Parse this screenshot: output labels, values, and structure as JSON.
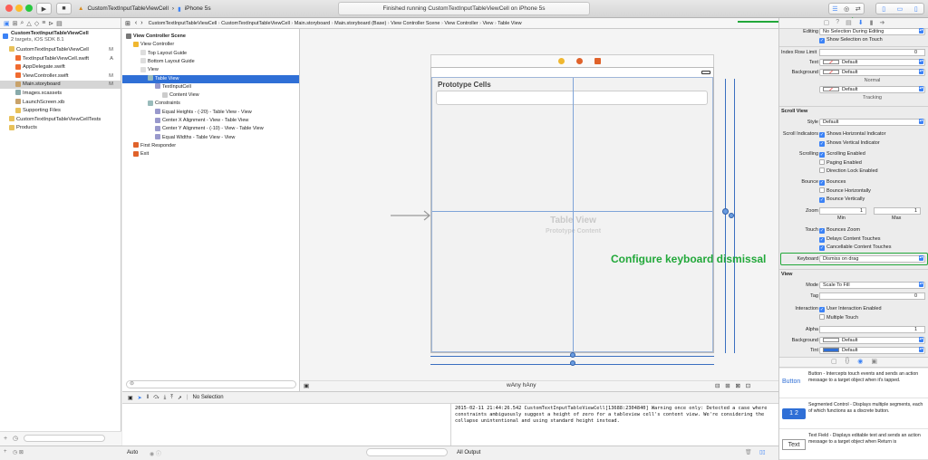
{
  "window": {
    "scheme": "CustomTextInputTableViewCell",
    "device": "iPhone 5s",
    "status": "Finished running CustomTextInputTableViewCell on iPhone 5s"
  },
  "jumpbar": [
    "CustomTextInputTableViewCell",
    "CustomTextInputTableViewCell",
    "Main.storyboard",
    "Main.storyboard (Base)",
    "View Controller Scene",
    "View Controller",
    "View",
    "Table View"
  ],
  "navigator": {
    "project": "CustomTextInputTableViewCell",
    "project_sub": "2 targets, iOS SDK 8.1",
    "items": [
      {
        "label": "CustomTextInputTableViewCell",
        "indent": 1,
        "kind": "folder",
        "flag": "M"
      },
      {
        "label": "TextInputTableViewCell.swift",
        "indent": 2,
        "kind": "swift",
        "flag": "A"
      },
      {
        "label": "AppDelegate.swift",
        "indent": 2,
        "kind": "swift",
        "flag": ""
      },
      {
        "label": "ViewController.swift",
        "indent": 2,
        "kind": "swift",
        "flag": "M"
      },
      {
        "label": "Main.storyboard",
        "indent": 2,
        "kind": "storyboard",
        "flag": "M",
        "selected": true
      },
      {
        "label": "Images.xcassets",
        "indent": 2,
        "kind": "assets",
        "flag": ""
      },
      {
        "label": "LaunchScreen.xib",
        "indent": 2,
        "kind": "xib",
        "flag": ""
      },
      {
        "label": "Supporting Files",
        "indent": 2,
        "kind": "folder",
        "flag": ""
      },
      {
        "label": "CustomTextInputTableViewCellTests",
        "indent": 1,
        "kind": "folder",
        "flag": ""
      },
      {
        "label": "Products",
        "indent": 1,
        "kind": "folder",
        "flag": ""
      }
    ]
  },
  "outline": [
    {
      "label": "View Controller Scene",
      "indent": 0,
      "bold": true
    },
    {
      "label": "View Controller",
      "indent": 1
    },
    {
      "label": "Top Layout Guide",
      "indent": 2
    },
    {
      "label": "Bottom Layout Guide",
      "indent": 2
    },
    {
      "label": "View",
      "indent": 2
    },
    {
      "label": "Table View",
      "indent": 3,
      "selected": true
    },
    {
      "label": "TextInputCell",
      "indent": 4
    },
    {
      "label": "Content View",
      "indent": 5
    },
    {
      "label": "Constraints",
      "indent": 3
    },
    {
      "label": "Equal Heights - (-20) - Table View - View",
      "indent": 4
    },
    {
      "label": "Center X Alignment - View - Table View",
      "indent": 4
    },
    {
      "label": "Center Y Alignment - (-10) - View - Table View",
      "indent": 4
    },
    {
      "label": "Equal Widths - Table View - View",
      "indent": 4
    },
    {
      "label": "First Responder",
      "indent": 1
    },
    {
      "label": "Exit",
      "indent": 1
    }
  ],
  "canvas": {
    "prototype_cells": "Prototype Cells",
    "table_view": "Table View",
    "prototype_content": "Prototype Content",
    "size_class": "wAny hAny",
    "annotation": "Configure keyboard dismissal"
  },
  "debug": {
    "selection": "No Selection",
    "console": "2015-02-11 21:44:26.542 CustomTextInputTableViewCell[13688:2304840] Warning once only: Detected a case where constraints ambiguously suggest a height of zero for a tableview cell's content view. We're considering the collapse unintentional and using standard height instead.",
    "auto": "Auto",
    "output": "All Output"
  },
  "inspector": {
    "editing": "No Selection During Editing",
    "show_selection": "Show Selection on Touch",
    "index_row_limit": "Index Row Limit",
    "index_row_value": "0",
    "text_label": "Text",
    "text_value": "Default",
    "background_label": "Background",
    "background_value": "Default",
    "normal": "Normal",
    "tracking_value": "Default",
    "tracking": "Tracking",
    "scroll_view": "Scroll View",
    "style_label": "Style",
    "style_value": "Default",
    "indicators_label": "Scroll Indicators",
    "h_indicator": "Shows Horizontal Indicator",
    "v_indicator": "Shows Vertical Indicator",
    "scrolling_label": "Scrolling",
    "scroll_enabled": "Scrolling Enabled",
    "paging": "Paging Enabled",
    "direction_lock": "Direction Lock Enabled",
    "bounce_label": "Bounce",
    "bounces": "Bounces",
    "bounce_h": "Bounce Horizontally",
    "bounce_v": "Bounce Vertically",
    "zoom_label": "Zoom",
    "zoom_min": "1",
    "zoom_max": "1",
    "min": "Min",
    "max": "Max",
    "touch_label": "Touch",
    "bounces_zoom": "Bounces Zoom",
    "delays": "Delays Content Touches",
    "cancellable": "Cancellable Content Touches",
    "keyboard_label": "Keyboard",
    "keyboard_value": "Dismiss on drag",
    "view": "View",
    "mode_label": "Mode",
    "mode_value": "Scale To Fill",
    "tag_label": "Tag",
    "tag_value": "0",
    "interaction_label": "Interaction",
    "user_interaction": "User Interaction Enabled",
    "multiple_touch": "Multiple Touch",
    "alpha_label": "Alpha",
    "alpha_value": "1",
    "bg2_label": "Background",
    "bg2_value": "Default",
    "tint_label": "Tint",
    "tint_value": "Default",
    "library": [
      {
        "title": "Button",
        "desc": "Button - Intercepts touch events and sends an action message to a target object when it's tapped."
      },
      {
        "title": "Segmented Control",
        "desc": "Segmented Control - Displays multiple segments, each of which functions as a discrete button."
      },
      {
        "title": "Text Field",
        "desc": "Text Field - Displays editable text and sends an action message to a target object when Return is"
      }
    ]
  },
  "colors": {
    "accent": "#3b82f6",
    "annotation": "#22a83a",
    "selection": "#2f6fd6"
  }
}
